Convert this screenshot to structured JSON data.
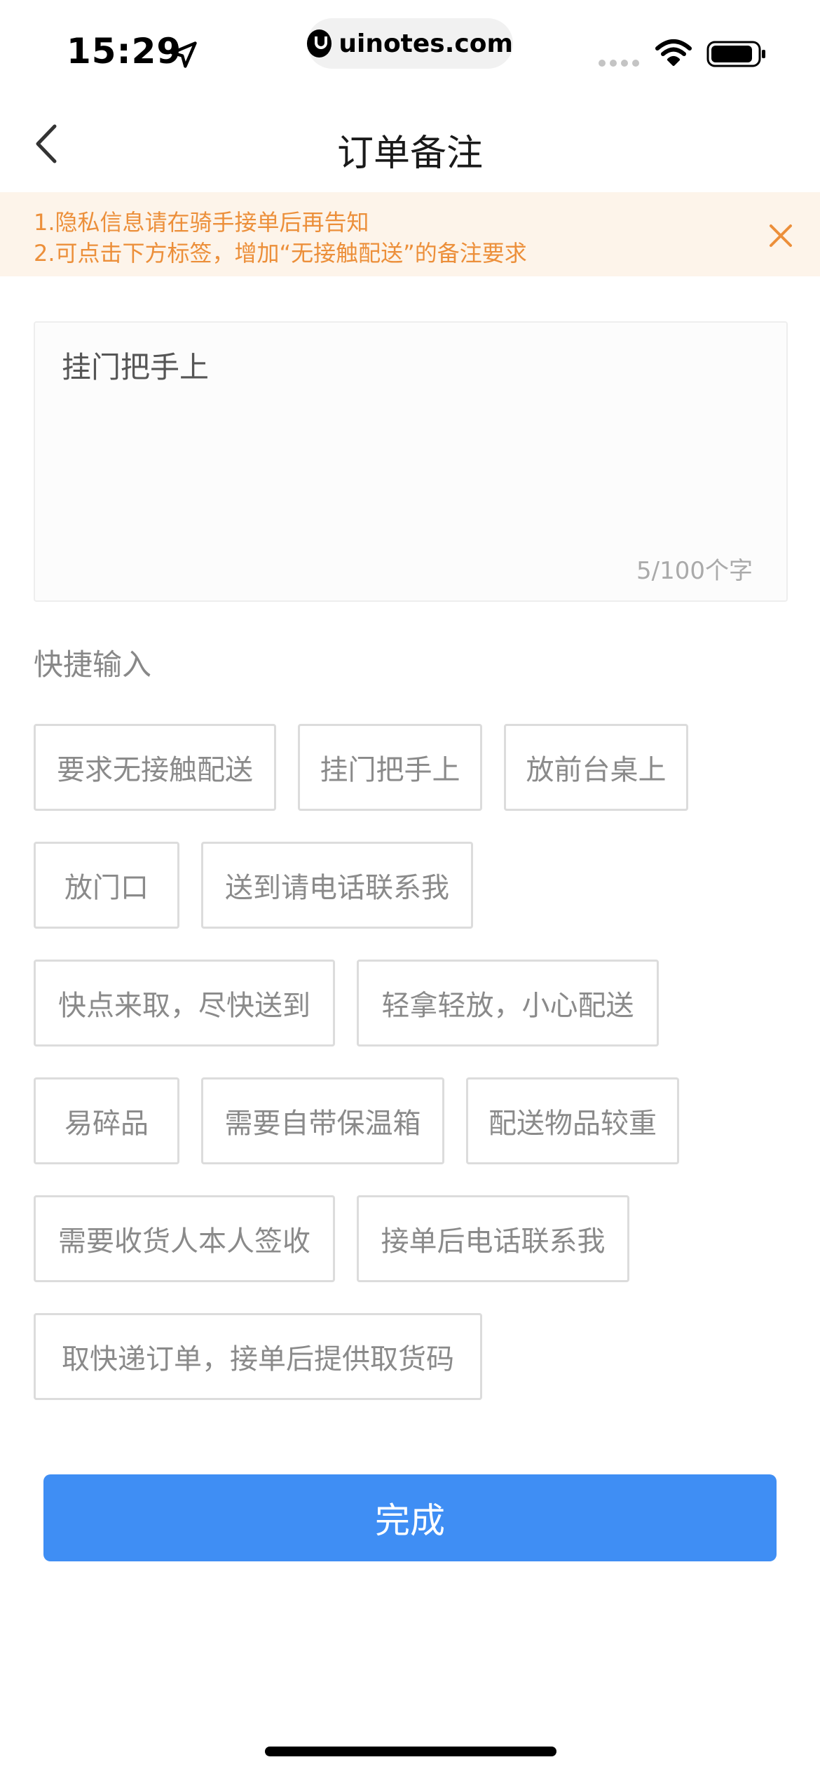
{
  "status_bar": {
    "time": "15:29",
    "url": "uinotes.com"
  },
  "nav": {
    "title": "订单备注"
  },
  "notice": {
    "line1": "1.隐私信息请在骑手接单后再告知",
    "line2": "2.可点击下方标签，增加“无接触配送”的备注要求"
  },
  "remark": {
    "value": "挂门把手上",
    "char_count": "5/100个字"
  },
  "quick_input": {
    "title": "快捷输入",
    "tags": [
      "要求无接触配送",
      "挂门把手上",
      "放前台桌上",
      "放门口",
      "送到请电话联系我",
      "快点来取，尽快送到",
      "轻拿轻放，小心配送",
      "易碎品",
      "需要自带保温箱",
      "配送物品较重",
      "需要收货人本人签收",
      "接单后电话联系我",
      "取快递订单，接单后提供取货码"
    ]
  },
  "done_button": {
    "label": "完成"
  },
  "colors": {
    "notice_text": "#ec8f3a",
    "notice_bg": "#fdf4ea",
    "primary": "#3f8ef4"
  }
}
